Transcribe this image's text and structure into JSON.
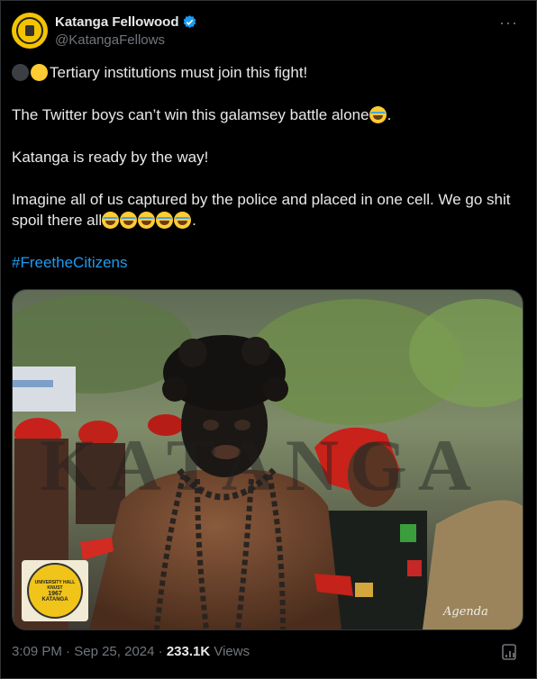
{
  "author": {
    "name": "Katanga Fellowood",
    "handle": "@KatangaFellows",
    "verified": true
  },
  "more_menu_icon": "ellipsis-icon",
  "tweet": {
    "line1_text": "Tertiary institutions must join this fight!",
    "line2_text": "The Twitter boys can’t win this galamsey battle alone",
    "line2_end": ".",
    "line3_text": "Katanga is ready by the way!",
    "line4_text": "Imagine all of us captured by the police and placed in one cell. We go shit spoil there all",
    "line4_end": ".",
    "hashtag": "#FreetheCitizens"
  },
  "media": {
    "watermark": "KATANGA",
    "badge_text_top": "UNIVERSITY HALL KNUST",
    "badge_year": "1967",
    "badge_text_bottom": "KATANGA",
    "signature": "Agenda"
  },
  "footer": {
    "time": "3:09 PM",
    "sep1": " · ",
    "date": "Sep 25, 2024",
    "sep2": " · ",
    "views_count": "233.1K",
    "views_label": " Views"
  },
  "colors": {
    "background": "#000000",
    "text": "#e7e9ea",
    "muted": "#71767b",
    "link": "#1d9bf0",
    "verified": "#1d9bf0"
  }
}
